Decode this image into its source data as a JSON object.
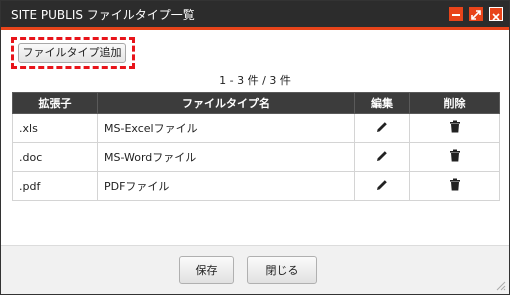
{
  "window": {
    "title": "SITE PUBLIS ファイルタイプ一覧",
    "accent_color": "#e8441a",
    "titlebar_color": "#2c2c2c",
    "controls": [
      "minimize-icon",
      "maximize-icon",
      "close-icon"
    ]
  },
  "toolbar": {
    "add_label": "ファイルタイプ追加"
  },
  "pager": {
    "text": "1 - 3 件 / 3 件"
  },
  "table": {
    "headers": {
      "extension": "拡張子",
      "name": "ファイルタイプ名",
      "edit": "編集",
      "delete": "削除"
    },
    "rows": [
      {
        "extension": ".xls",
        "name": "MS-Excelファイル"
      },
      {
        "extension": ".doc",
        "name": "MS-Wordファイル"
      },
      {
        "extension": ".pdf",
        "name": "PDFファイル"
      }
    ],
    "row_icons": {
      "edit": "pencil-icon",
      "delete": "trash-icon"
    }
  },
  "footer": {
    "save_label": "保存",
    "close_label": "閉じる"
  },
  "highlight": {
    "color": "#e8141a",
    "style": "dashed"
  }
}
